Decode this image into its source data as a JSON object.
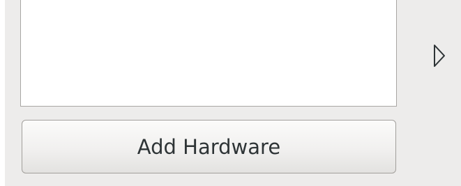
{
  "colors": {
    "window_background": "#edeceb",
    "list_background": "#ffffff",
    "text": "#2e3436"
  },
  "hardware_list": {
    "items": []
  },
  "add_hardware_button": {
    "label": "Add Hardware"
  },
  "side_expander": {
    "icon": "triangle-right-icon",
    "state": "collapsed"
  }
}
